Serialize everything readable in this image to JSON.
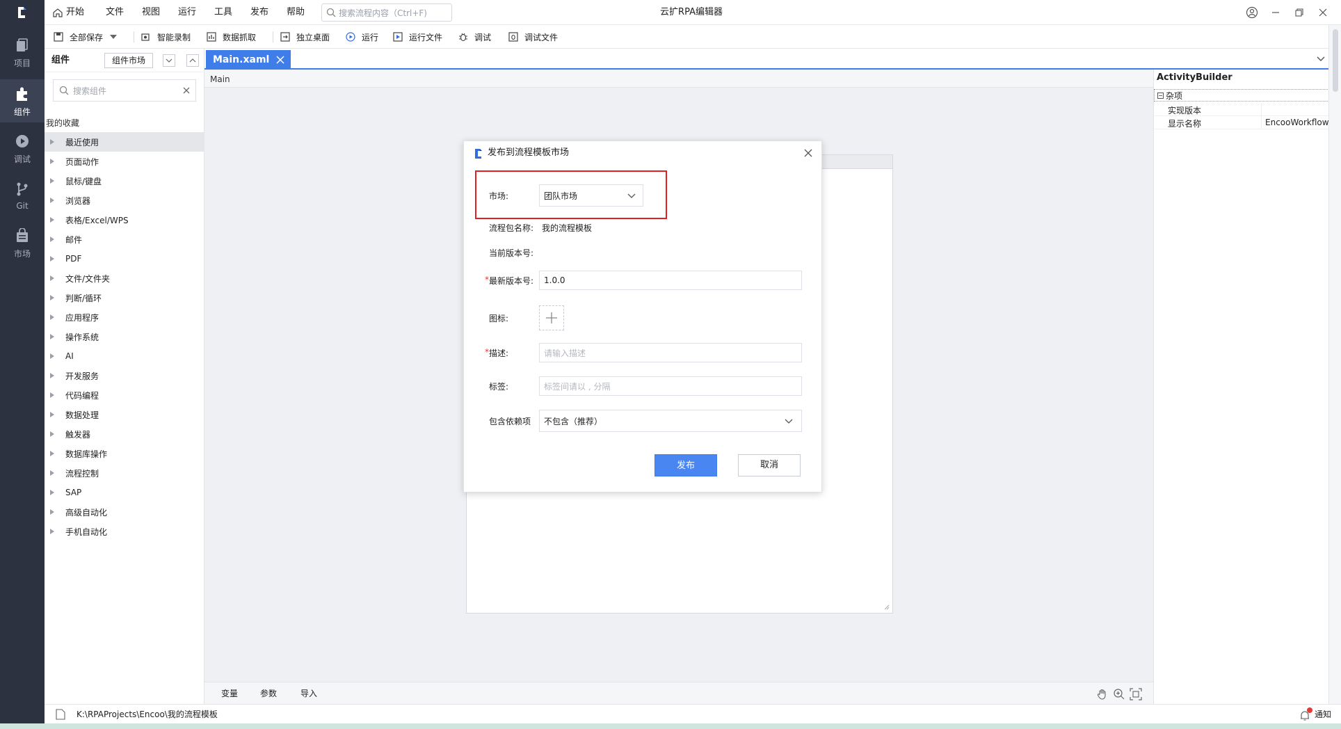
{
  "activity_bar": {
    "items": [
      {
        "label": "项目",
        "icon": "project-icon"
      },
      {
        "label": "组件",
        "icon": "puzzle-icon",
        "active": true
      },
      {
        "label": "调试",
        "icon": "play-icon"
      },
      {
        "label": "Git",
        "icon": "git-branch-icon"
      },
      {
        "label": "市场",
        "icon": "market-bag-icon"
      }
    ]
  },
  "menubar": {
    "items": [
      "开始",
      "文件",
      "视图",
      "运行",
      "工具",
      "发布",
      "帮助"
    ],
    "search_placeholder": "搜索流程内容（Ctrl+F)",
    "app_title": "云扩RPA编辑器"
  },
  "toolbar": {
    "save_all": "全部保存",
    "smart_record": "智能录制",
    "data_capture": "数据抓取",
    "standalone_desktop": "独立桌面",
    "run": "运行",
    "run_file": "运行文件",
    "debug": "调试",
    "debug_file": "调试文件"
  },
  "component_panel": {
    "title": "组件",
    "market_button": "组件市场",
    "search_placeholder": "搜索组件",
    "favorites_label": "我的收藏",
    "categories": [
      "最近使用",
      "页面动作",
      "鼠标/键盘",
      "浏览器",
      "表格/Excel/WPS",
      "邮件",
      "PDF",
      "文件/文件夹",
      "判断/循环",
      "应用程序",
      "操作系统",
      "AI",
      "开发服务",
      "代码编程",
      "数据处理",
      "触发器",
      "数据库操作",
      "流程控制",
      "SAP",
      "高级自动化",
      "手机自动化"
    ],
    "selected_index": 0
  },
  "editor": {
    "tab_label": "Main.xaml",
    "breadcrumb": "Main"
  },
  "designer_bottom": {
    "tabs": [
      "变量",
      "参数",
      "导入"
    ]
  },
  "properties": {
    "title": "ActivityBuilder",
    "category": "杂项",
    "rows": [
      {
        "key": "实现版本",
        "value": ""
      },
      {
        "key": "显示名称",
        "value": "EncooWorkflow"
      }
    ]
  },
  "statusbar": {
    "path": "K:\\RPAProjects\\Encoo\\我的流程模板",
    "notify_label": "通知"
  },
  "modal": {
    "title": "发布到流程模板市场",
    "market_label": "市场:",
    "market_value": "团队市场",
    "package_name_label": "流程包名称:",
    "package_name_value": "我的流程模板",
    "current_version_label": "当前版本号:",
    "current_version_value": "",
    "new_version_label": "最新版本号:",
    "new_version_value": "1.0.0",
    "icon_label": "图标:",
    "description_label": "描述:",
    "description_placeholder": "请输入描述",
    "tags_label": "标签:",
    "tags_placeholder": "标签间请以 , 分隔",
    "dependencies_label": "包含依赖项",
    "dependencies_value": "不包含（推荐）",
    "publish_button": "发布",
    "cancel_button": "取消"
  },
  "colors": {
    "accent": "#3f7ee8",
    "highlight_border": "#e02020",
    "sidebar_bg": "#2d3240"
  }
}
